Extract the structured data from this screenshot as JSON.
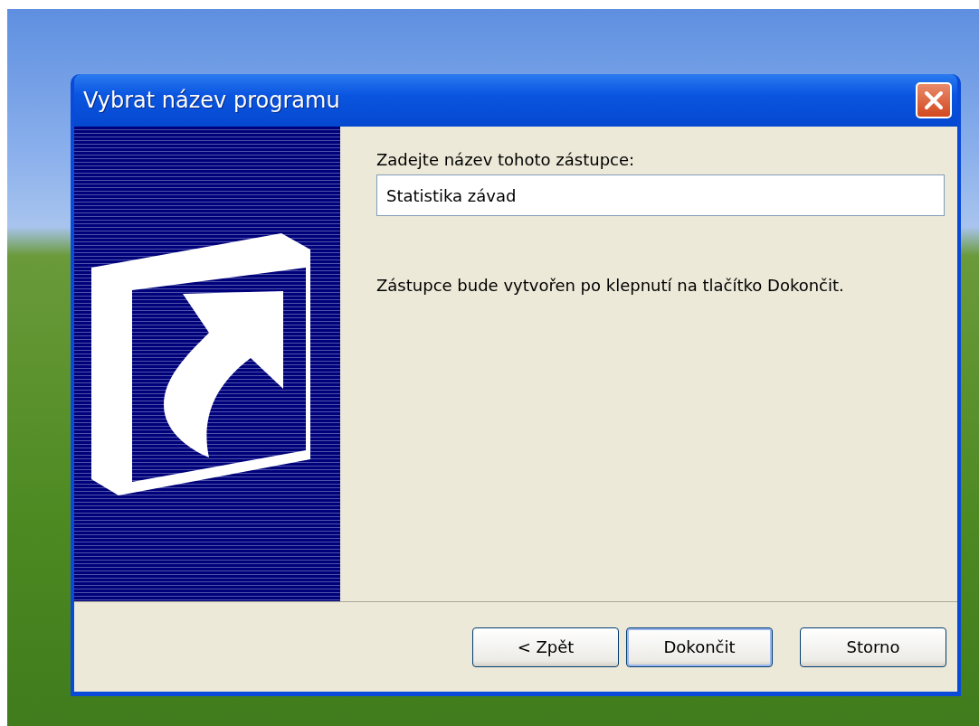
{
  "window": {
    "title": "Vybrat název programu"
  },
  "prompt": "Zadejte název tohoto zástupce:",
  "name_field": {
    "value": "Statistika závad"
  },
  "info": "Zástupce bude vytvořen po klepnutí na tlačítko Dokončit.",
  "buttons": [
    {
      "label": "< Zpět",
      "default": false
    },
    {
      "label": "Dokončit",
      "default": true
    },
    {
      "label": "Storno",
      "default": false
    }
  ]
}
